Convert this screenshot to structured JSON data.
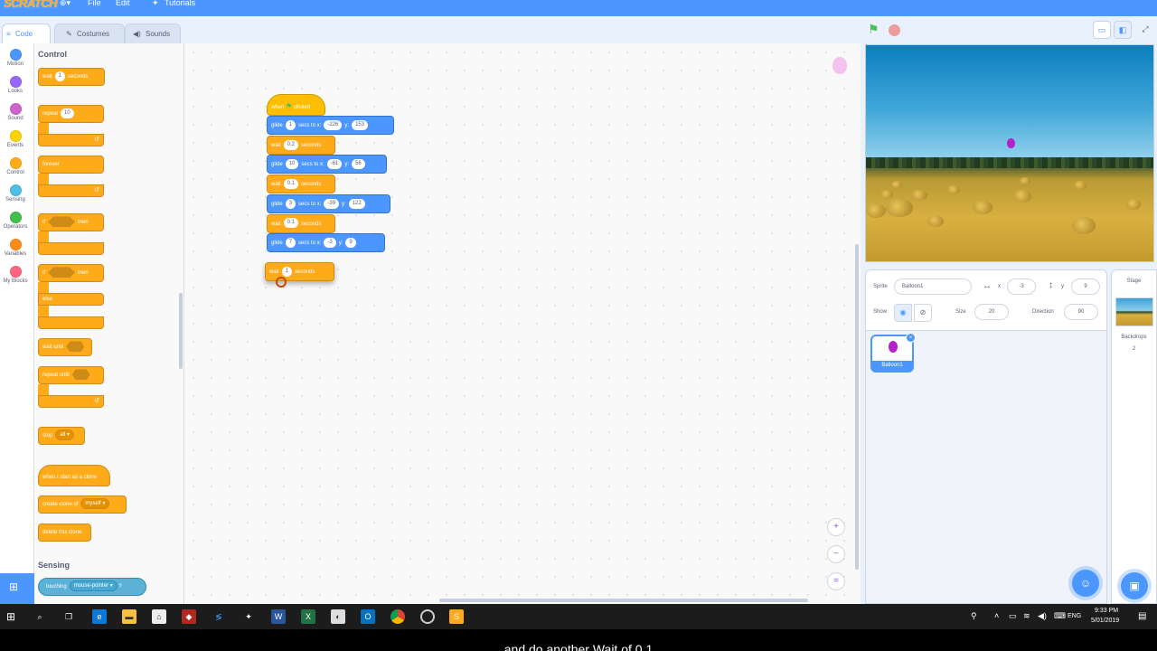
{
  "menu": {
    "logo": "SCRATCH",
    "file": "File",
    "edit": "Edit",
    "tutorials": "Tutorials",
    "globe_icon": "globe-icon"
  },
  "tabs": [
    {
      "label": "Code"
    },
    {
      "label": "Costumes"
    },
    {
      "label": "Sounds"
    }
  ],
  "categories": [
    {
      "label": "Motion",
      "color": "#4c97ff"
    },
    {
      "label": "Looks",
      "color": "#9966ff"
    },
    {
      "label": "Sound",
      "color": "#cf63cf"
    },
    {
      "label": "Events",
      "color": "#ffd500"
    },
    {
      "label": "Control",
      "color": "#ffab19"
    },
    {
      "label": "Sensing",
      "color": "#4cbfe6"
    },
    {
      "label": "Operators",
      "color": "#40bf4a"
    },
    {
      "label": "Variables",
      "color": "#ff8c1a"
    },
    {
      "label": "My Blocks",
      "color": "#ff6680"
    }
  ],
  "palette": {
    "control_title": "Control",
    "wait": {
      "label": "wait",
      "value": "1",
      "unit": "seconds"
    },
    "repeat": {
      "label": "repeat",
      "value": "10"
    },
    "forever": "forever",
    "if_then": {
      "if": "if",
      "then": "then"
    },
    "if_else": {
      "if": "if",
      "then": "then",
      "else": "else"
    },
    "wait_until": "wait until",
    "repeat_until": "repeat until",
    "stop": {
      "label": "stop",
      "value": "all"
    },
    "clone_start": "when I start as a clone",
    "create_clone": {
      "label": "create clone of",
      "value": "myself"
    },
    "delete_clone": "delete this clone",
    "sensing_title": "Sensing",
    "touching": {
      "label": "touching",
      "value": "mouse-pointer",
      "q": "?"
    }
  },
  "script": {
    "hat": {
      "when": "when",
      "clicked": "clicked"
    },
    "steps": [
      {
        "type": "glide",
        "secs": "1",
        "x": "-226",
        "y": "153"
      },
      {
        "type": "wait",
        "secs": "0.2"
      },
      {
        "type": "glide",
        "secs": "10",
        "x": "-61",
        "y": "56"
      },
      {
        "type": "wait",
        "secs": "0.1"
      },
      {
        "type": "glide",
        "secs": "3",
        "x": "-39",
        "y": "122"
      },
      {
        "type": "wait",
        "secs": "0.1"
      },
      {
        "type": "glide",
        "secs": "7",
        "x": "-3",
        "y": "9"
      }
    ],
    "glide_label": "glide",
    "secs_to_x": "secs to x:",
    "y_label": "y:",
    "wait_label": "wait",
    "seconds_label": "seconds",
    "dragging": {
      "label": "wait",
      "value": "1",
      "unit": "seconds"
    }
  },
  "zoom": {
    "in": "+",
    "out": "−",
    "reset": "="
  },
  "sprite_info": {
    "sprite_label": "Sprite",
    "sprite_name": "Balloon1",
    "x_label": "x",
    "x": "-3",
    "y_label": "y",
    "y": "9",
    "show_label": "Show",
    "size_label": "Size",
    "size": "20",
    "direction_label": "Direction",
    "direction": "90"
  },
  "sprites": [
    {
      "name": "Balloon1",
      "color": "#b620c9"
    }
  ],
  "stage_panel": {
    "title": "Stage",
    "backdrops_label": "Backdrops",
    "backdrops_count": "2"
  },
  "taskbar": {
    "time": "9:33 PM",
    "date": "5/01/2019",
    "lang": "ENG"
  },
  "caption": "and do another Wait of 0.1"
}
